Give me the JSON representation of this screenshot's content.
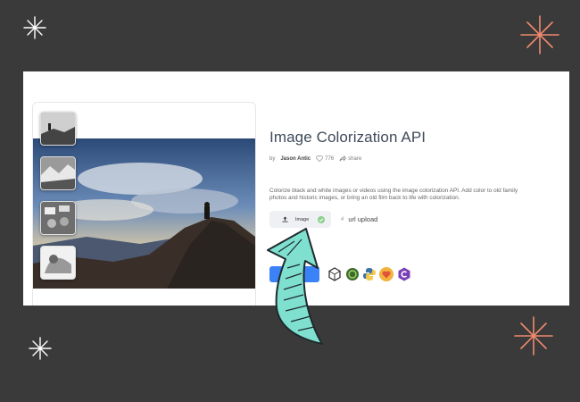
{
  "page": {
    "title": "Image Colorization API",
    "author_prefix": "by",
    "author": "Jason Antic",
    "likes": "776",
    "share_label": "share",
    "description": "Colorize black and white images or videos using the image colorization API. Add color to old family photos and historic images, or bring an old film back to life with colorization.",
    "image_button_label": "Image",
    "url_upload_label": "url upload",
    "url_icon": "#"
  },
  "icons": {
    "upload": "upload-icon",
    "check": "check-circle-icon",
    "heart": "heart-icon",
    "share": "share-icon"
  },
  "colors": {
    "background": "#3a3a3a",
    "primary_button": "#3b82f6",
    "arrow": "#7fe0d0",
    "sparkle_orange": "#f08a6e"
  }
}
